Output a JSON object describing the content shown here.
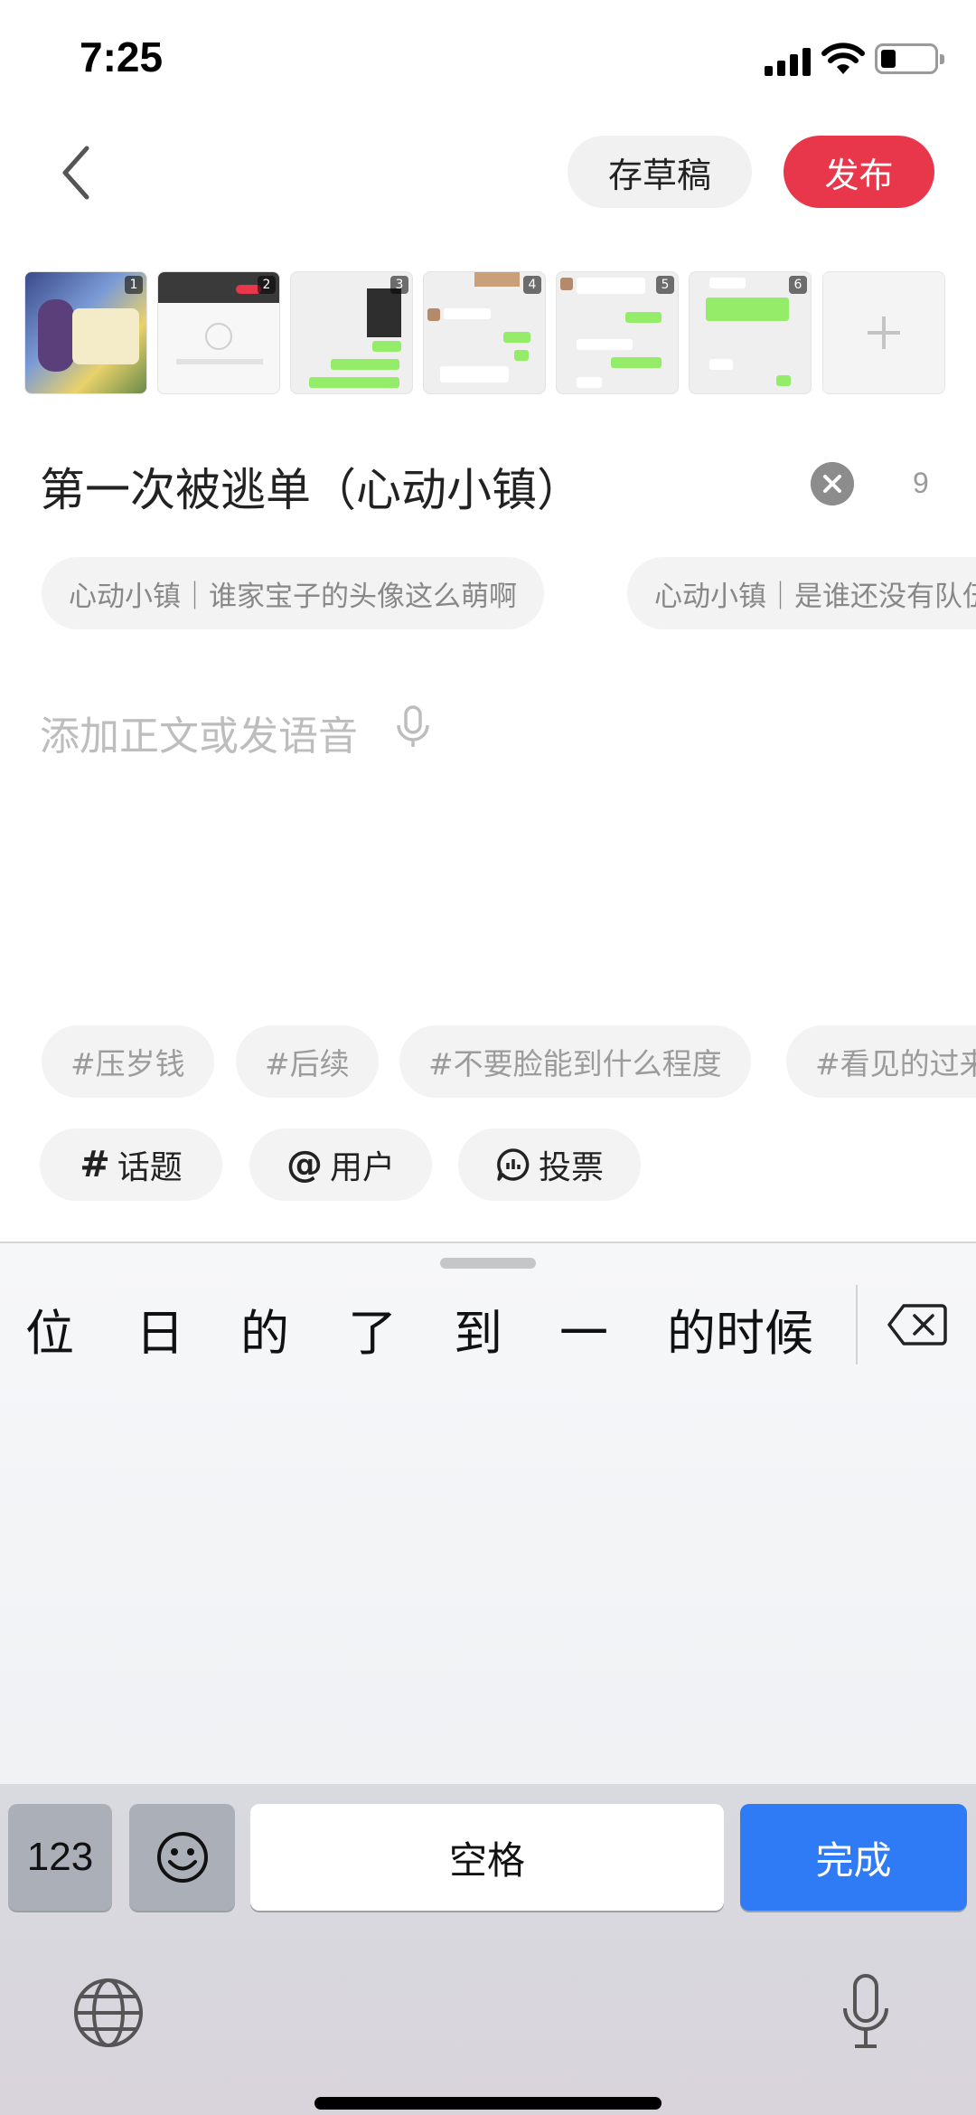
{
  "status_bar": {
    "time": "7:25",
    "icons": [
      "signal-icon",
      "wifi-icon",
      "battery-icon"
    ]
  },
  "header": {
    "back_icon": "chevron-left-icon",
    "save_draft_label": "存草稿",
    "publish_label": "发布",
    "publish_color": "#e8374a"
  },
  "images": {
    "thumbnails": [
      {
        "index": "1"
      },
      {
        "index": "2"
      },
      {
        "index": "3"
      },
      {
        "index": "4"
      },
      {
        "index": "5"
      },
      {
        "index": "6"
      }
    ],
    "add_icon": "plus-icon"
  },
  "title_field": {
    "value": "第一次被逃单（心动小镇）",
    "char_count": "9",
    "clear_icon": "close-circle-icon"
  },
  "title_suggestions": [
    "心动小镇｜谁家宝子的头像这么萌啊",
    "心动小镇｜是谁还没有队伍"
  ],
  "body_field": {
    "placeholder": "添加正文或发语音",
    "mic_icon": "microphone-icon"
  },
  "hashtag_suggestions": [
    "#压岁钱",
    "#后续",
    "#不要脸能到什么程度",
    "#看见的过来"
  ],
  "tools": [
    {
      "icon": "#",
      "label": "话题"
    },
    {
      "icon": "@",
      "label": "用户"
    },
    {
      "icon": "poll-icon",
      "label": "投票"
    }
  ],
  "keyboard": {
    "candidates": [
      "位",
      "日",
      "的",
      "了",
      "到",
      "一",
      "的时候"
    ],
    "delete_icon": "backspace-icon",
    "key_123": "123",
    "emoji_icon": "emoji-icon",
    "space_label": "空格",
    "done_label": "完成",
    "done_color": "#2f7bf5",
    "globe_icon": "globe-icon",
    "mic_icon": "microphone-icon"
  }
}
